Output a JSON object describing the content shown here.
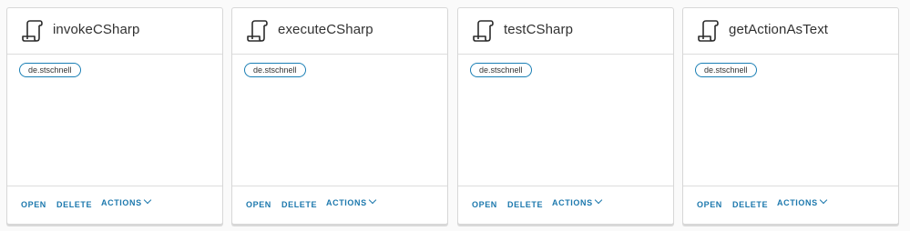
{
  "actions": {
    "open_label": "OPEN",
    "delete_label": "DELETE",
    "actions_label": "ACTIONS"
  },
  "cards": [
    {
      "title": "invokeCSharp",
      "tag": "de.stschnell",
      "icon": "script-scroll-icon"
    },
    {
      "title": "executeCSharp",
      "tag": "de.stschnell",
      "icon": "script-scroll-icon"
    },
    {
      "title": "testCSharp",
      "tag": "de.stschnell",
      "icon": "script-scroll-icon"
    },
    {
      "title": "getActionAsText",
      "tag": "de.stschnell",
      "icon": "script-scroll-icon"
    }
  ],
  "colors": {
    "accent": "#1c78ad",
    "tag_border": "#1a7fb5",
    "title_text": "#313131"
  }
}
